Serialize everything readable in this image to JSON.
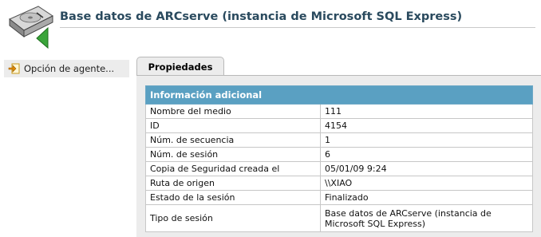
{
  "header": {
    "title": "Base datos de ARCserve (instancia de Microsoft SQL Express)",
    "icon": "database-restore-icon"
  },
  "sidebar": {
    "items": [
      {
        "label": "Opción de agente...",
        "icon": "arrow-in-box-icon"
      }
    ]
  },
  "tabs": [
    {
      "label": "Propiedades",
      "active": true
    }
  ],
  "info": {
    "section_title": "Información adicional",
    "rows": [
      {
        "key": "Nombre del medio",
        "value": "111"
      },
      {
        "key": "ID",
        "value": "4154"
      },
      {
        "key": "Núm. de secuencia",
        "value": "1"
      },
      {
        "key": "Núm. de sesión",
        "value": "6"
      },
      {
        "key": "Copia de Seguridad creada el",
        "value": "05/01/09 9:24"
      },
      {
        "key": "Ruta de origen",
        "value": "\\\\XIAO"
      },
      {
        "key": "Estado de la sesión",
        "value": "Finalizado"
      },
      {
        "key": "Tipo de sesión",
        "value": "Base datos de ARCserve (instancia de Microsoft SQL Express)"
      }
    ]
  },
  "colors": {
    "title": "#2a4a5e",
    "table_header": "#5aa0c2",
    "panel_bg": "#ececec"
  }
}
